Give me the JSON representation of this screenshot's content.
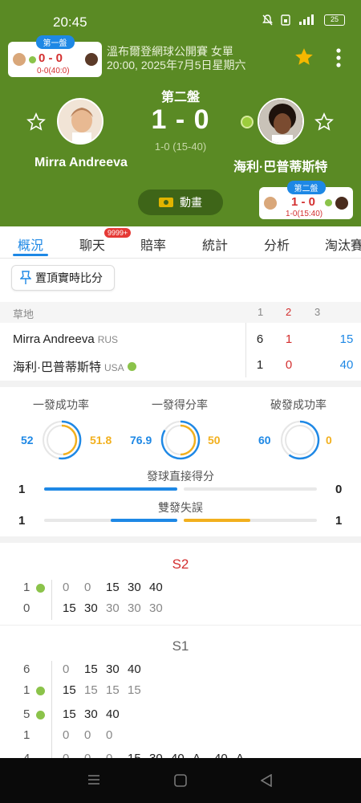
{
  "status_bar": {
    "time": "20:45",
    "battery": "25"
  },
  "mini_card_left": {
    "set": "第一盤",
    "score": "0 - 0",
    "sub": "0-0(40:0)"
  },
  "match": {
    "tournament": "溫布爾登網球公開賽 女單",
    "datetime": "20:00, 2025年7月5日星期六",
    "current_set_label": "第二盤",
    "score": "1 - 0",
    "sub_score": "1-0 (15-40)",
    "animation_label": "動畫"
  },
  "mini_card_right": {
    "set": "第二盤",
    "score": "1 - 0",
    "sub": "1-0(15:40)"
  },
  "players": {
    "home": {
      "name": "Mirra Andreeva",
      "country": "RUS"
    },
    "away": {
      "name": "海利·巴普蒂斯特",
      "country": "USA"
    }
  },
  "tabs": [
    {
      "label": "概況",
      "active": true
    },
    {
      "label": "聊天",
      "badge": "9999+"
    },
    {
      "label": "賠率"
    },
    {
      "label": "統計"
    },
    {
      "label": "分析"
    },
    {
      "label": "淘汰賽"
    }
  ],
  "pin_button": "置頂實時比分",
  "score_table": {
    "surface": "草地",
    "columns": [
      "1",
      "2",
      "3"
    ],
    "rows": [
      {
        "name": "Mirra Andreeva",
        "country": "RUS",
        "sets": [
          "6",
          "1"
        ],
        "points": "15"
      },
      {
        "name": "海利·巴普蒂斯特",
        "country": "USA",
        "sets": [
          "1",
          "0"
        ],
        "points": "40"
      }
    ]
  },
  "stats": {
    "first_serve_pct": {
      "label": "一發成功率",
      "home": "52",
      "away": "51.8"
    },
    "first_serve_won": {
      "label": "一發得分率",
      "home": "76.9",
      "away": "50"
    },
    "break_points": {
      "label": "破發成功率",
      "home": "60",
      "away": "0"
    },
    "aces": {
      "label": "發球直接得分",
      "home": "1",
      "away": "0",
      "home_share": 1.0,
      "away_share": 0.0
    },
    "double_faults": {
      "label": "雙發失誤",
      "home": "1",
      "away": "1",
      "home_share": 0.5,
      "away_share": 0.5
    }
  },
  "point_by_point": [
    {
      "set": "S2",
      "games": [
        {
          "home_games": "1",
          "away_games": "0",
          "server": "home",
          "home_points": [
            "0",
            "0",
            "15",
            "30",
            "40"
          ],
          "away_points": [
            "15",
            "30",
            "30",
            "30",
            "30"
          ]
        }
      ]
    },
    {
      "set": "S1",
      "games": [
        {
          "home_games": "6",
          "away_games": "1",
          "server": "away",
          "home_points": [
            "0",
            "15",
            "30",
            "40"
          ],
          "away_points": [
            "15",
            "15",
            "15",
            "15"
          ]
        },
        {
          "home_games": "5",
          "away_games": "1",
          "server": "home",
          "home_points": [
            "15",
            "30",
            "40"
          ],
          "away_points": [
            "0",
            "0",
            "0"
          ]
        },
        {
          "home_games": "4",
          "away_games": "",
          "home_points": [
            "0",
            "0",
            "0",
            "15",
            "30",
            "40",
            "A",
            "40",
            "A"
          ]
        }
      ]
    }
  ],
  "colors": {
    "header_green": "#5a8a24",
    "accent_blue": "#1e88e5",
    "stat_yellow": "#f2b01e",
    "lead_red": "#d32f2f"
  }
}
